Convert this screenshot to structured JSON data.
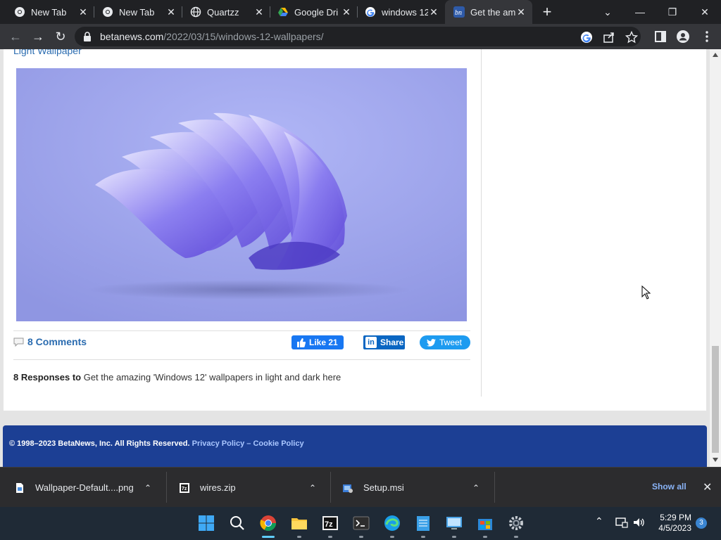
{
  "browser": {
    "tabs": [
      {
        "title": "New Tab",
        "favicon": "chrome-icon"
      },
      {
        "title": "New Tab",
        "favicon": "chrome-icon"
      },
      {
        "title": "Quartzz",
        "favicon": "globe-icon"
      },
      {
        "title": "Google Dri",
        "favicon": "google-drive-icon"
      },
      {
        "title": "windows 12",
        "favicon": "google-icon"
      },
      {
        "title": "Get the am",
        "favicon": "betanews-icon",
        "active": true
      }
    ],
    "url_host": "betanews.com",
    "url_path": "/2022/03/15/windows-12-wallpapers/"
  },
  "article": {
    "caption_link": "Light Wallpaper",
    "comments_label": "8 Comments",
    "share": {
      "facebook": "Like 21",
      "linkedin": "Share",
      "twitter": "Tweet"
    },
    "responses_bold": "8 Responses to",
    "responses_text": "Get the amazing 'Windows 12' wallpapers in light and dark here"
  },
  "footer": {
    "copyright": "© 1998–2023 BetaNews, Inc. All Rights Reserved.",
    "privacy": "Privacy Policy",
    "separator": "–",
    "cookie": "Cookie Policy"
  },
  "downloads": {
    "items": [
      {
        "name": "Wallpaper-Default....png",
        "icon": "image-file-icon"
      },
      {
        "name": "wires.zip",
        "icon": "7zip-file-icon"
      },
      {
        "name": "Setup.msi",
        "icon": "installer-file-icon"
      }
    ],
    "show_all": "Show all"
  },
  "taskbar": {
    "time": "5:29 PM",
    "date": "4/5/2023",
    "notification_count": "3"
  },
  "colors": {
    "footer_bg": "#1c3f94",
    "link": "#2b6cb0",
    "facebook": "#1877f2",
    "linkedin": "#0a66c2",
    "twitter": "#1d9bf0"
  }
}
